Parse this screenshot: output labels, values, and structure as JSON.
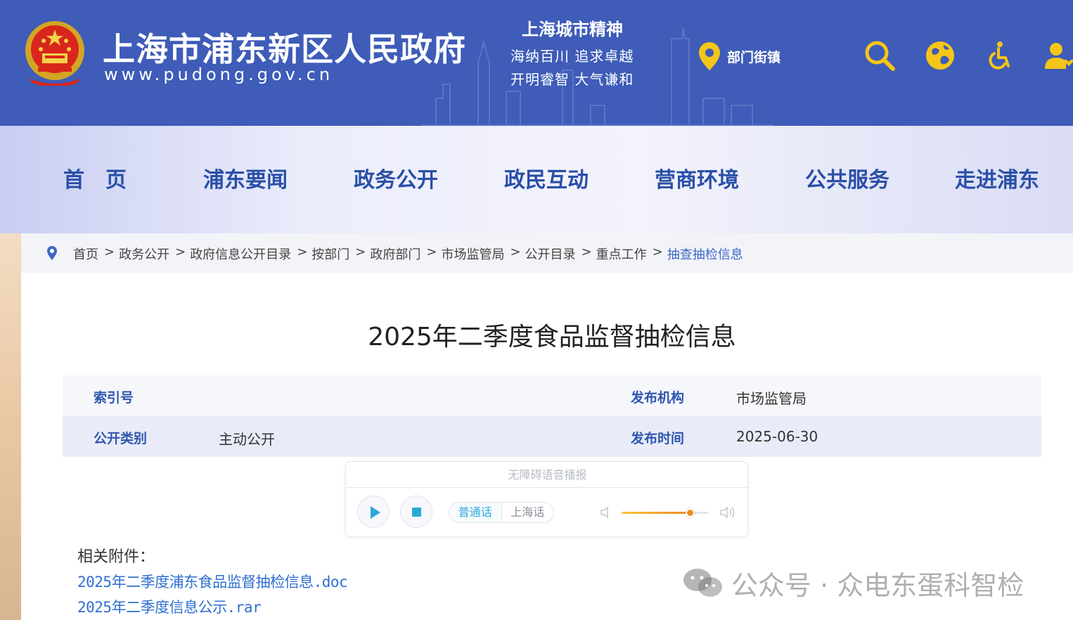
{
  "header": {
    "site_title": "上海市浦东新区人民政府",
    "site_url": "www.pudong.gov.cn",
    "spirit_title": "上海城市精神",
    "spirit_line1": "海纳百川  追求卓越",
    "spirit_line2": "开明睿智  大气谦和",
    "dept_link": "部门街镇",
    "icons": [
      "map-pin-icon",
      "search-icon",
      "globe-icon",
      "accessibility-icon",
      "user-icon"
    ]
  },
  "nav": {
    "items": [
      "首　页",
      "浦东要闻",
      "政务公开",
      "政民互动",
      "营商环境",
      "公共服务",
      "走进浦东"
    ]
  },
  "breadcrumb": {
    "items": [
      "首页",
      "政务公开",
      "政府信息公开目录",
      "按部门",
      "政府部门",
      "市场监管局",
      "公开目录",
      "重点工作",
      "抽查抽检信息"
    ],
    "separator": ">"
  },
  "article": {
    "title": "2025年二季度食品监督抽检信息",
    "meta": {
      "index_label": "索引号",
      "index_value": "",
      "publisher_label": "发布机构",
      "publisher_value": "市场监管局",
      "category_label": "公开类别",
      "category_value": "主动公开",
      "date_label": "发布时间",
      "date_value": "2025-06-30"
    }
  },
  "player": {
    "title": "无障碍语音播报",
    "lang_mandarin": "普通话",
    "lang_shanghai": "上海话",
    "active_lang": "普通话",
    "volume": 0.78,
    "colors": {
      "play": "#2ba8d8",
      "volume": "#f08a24"
    }
  },
  "attachments": {
    "label": "相关附件：",
    "files": [
      "2025年二季度浦东食品监督抽检信息.doc",
      "2025年二季度信息公示.rar"
    ]
  },
  "watermark": {
    "text": "公众号 · 众电东蛋科智检"
  },
  "colors": {
    "header_bg": "#3e5cb8",
    "nav_text": "#2a4fa8",
    "meta_label": "#2f57b0",
    "link": "#2f6fd0"
  }
}
